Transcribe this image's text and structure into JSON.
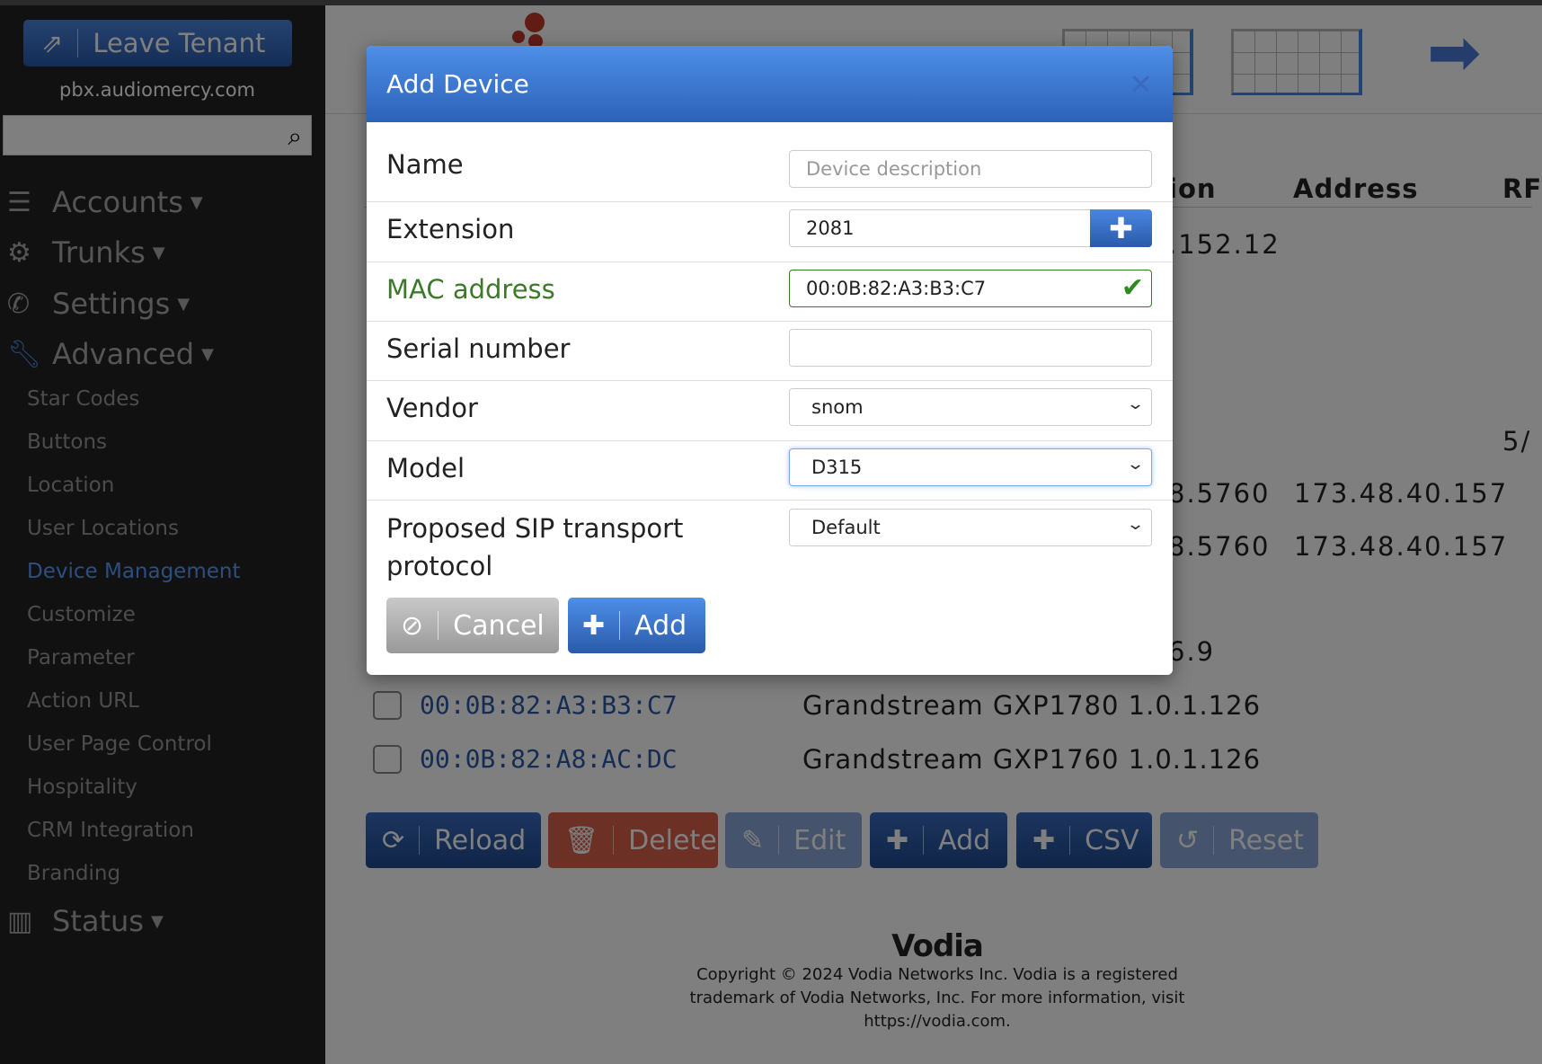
{
  "sidebar": {
    "leave_tenant": "Leave Tenant",
    "domain": "pbx.audiomercy.com",
    "search_value": "",
    "nav": [
      {
        "label": "Accounts",
        "icon": "list-icon"
      },
      {
        "label": "Trunks",
        "icon": "gears-icon"
      },
      {
        "label": "Settings",
        "icon": "phone-icon"
      },
      {
        "label": "Advanced",
        "icon": "wrench-icon"
      }
    ],
    "sub_items": [
      "Star Codes",
      "Buttons",
      "Location",
      "User Locations",
      "Device Management",
      "Customize",
      "Parameter",
      "Action URL",
      "User Page Control",
      "Hospitality",
      "CRM Integration",
      "Branding"
    ],
    "active_item": "Device Management",
    "status": "Status"
  },
  "table": {
    "headers": [
      "ion",
      "Address",
      "RF"
    ],
    "fragments": [
      ".152.12",
      "5/",
      "8.5760",
      "173.48.40.157",
      "8.5760",
      "173.48.40.157",
      "6.9"
    ],
    "rows": [
      {
        "mac": "00:0B:82:A3:B3:C7",
        "vendor": "Grandstream",
        "model": "GXP1780",
        "version": "1.0.1.126"
      },
      {
        "mac": "00:0B:82:A8:AC:DC",
        "vendor": "Grandstream",
        "model": "GXP1760",
        "version": "1.0.1.126"
      }
    ]
  },
  "actions": {
    "reload": "Reload",
    "delete": "Delete",
    "edit": "Edit",
    "add": "Add",
    "csv": "CSV",
    "reset": "Reset"
  },
  "footer": {
    "logo": "Vodia",
    "line1": "Copyright © 2024 Vodia Networks Inc. Vodia is a registered",
    "line2": "trademark of Vodia Networks, Inc. For more information, visit",
    "line3": "https://vodia.com."
  },
  "modal": {
    "title": "Add Device",
    "fields": {
      "name": {
        "label": "Name",
        "value": "",
        "placeholder": "Device description"
      },
      "extension": {
        "label": "Extension",
        "value": "2081"
      },
      "mac": {
        "label": "MAC address",
        "value": "00:0B:82:A3:B3:C7",
        "valid": true
      },
      "serial": {
        "label": "Serial number",
        "value": ""
      },
      "vendor": {
        "label": "Vendor",
        "value": "snom"
      },
      "model": {
        "label": "Model",
        "value": "D315"
      },
      "transport": {
        "label": "Proposed SIP transport protocol",
        "value": "Default"
      }
    },
    "cancel": "Cancel",
    "add": "Add"
  },
  "colors": {
    "primary": "#2d62b8",
    "valid": "#3c7a2a",
    "danger": "#d9604a",
    "sidebar": "#111111"
  }
}
